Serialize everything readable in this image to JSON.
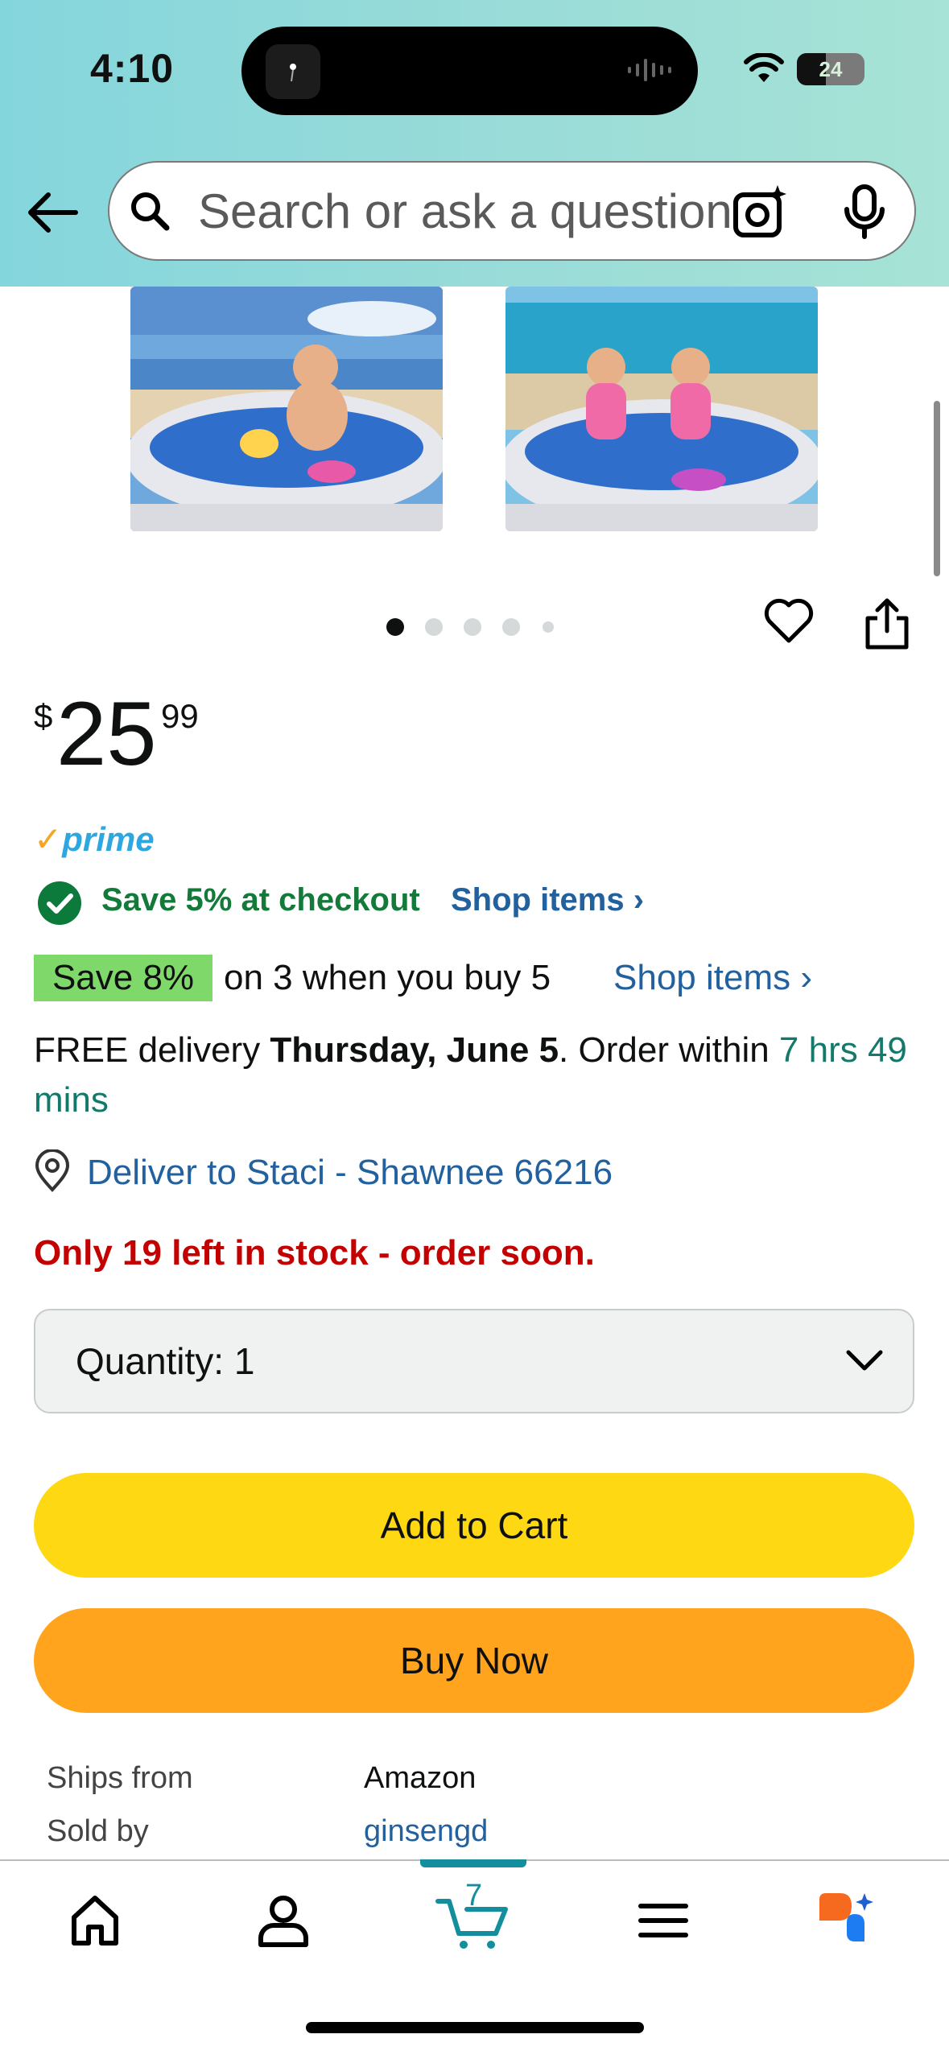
{
  "status_bar": {
    "time": "4:10",
    "battery": "24"
  },
  "search": {
    "placeholder": "Search or ask a question"
  },
  "gallery": {
    "image_count": 5,
    "active_index": 0
  },
  "price": {
    "symbol": "$",
    "whole": "25",
    "fraction": "99"
  },
  "prime": {
    "label": "prime"
  },
  "promo1": {
    "text": "Save 5% at checkout",
    "link": "Shop items ›"
  },
  "promo2": {
    "badge": "Save 8%",
    "text": "on 3 when you buy 5",
    "link": "Shop items ›"
  },
  "delivery": {
    "prefix": "FREE delivery ",
    "date": "Thursday, June 5",
    "middle": ". Order within ",
    "countdown": "7 hrs 49 mins"
  },
  "location": {
    "text": "Deliver to Staci - Shawnee 66216"
  },
  "stock": {
    "text": "Only 19 left in stock - order soon."
  },
  "quantity": {
    "label": "Quantity:",
    "value": "1"
  },
  "buttons": {
    "add_to_cart": "Add to Cart",
    "buy_now": "Buy Now"
  },
  "seller": {
    "ships_label": "Ships from",
    "ships_value": "Amazon",
    "sold_label": "Sold by",
    "sold_value": "ginsengd"
  },
  "nav": {
    "cart_count": "7"
  },
  "colors": {
    "add_to_cart": "#ffd814",
    "buy_now": "#ffa41c",
    "link": "#22619e",
    "stock": "#c40000",
    "accent": "#138e9c"
  }
}
